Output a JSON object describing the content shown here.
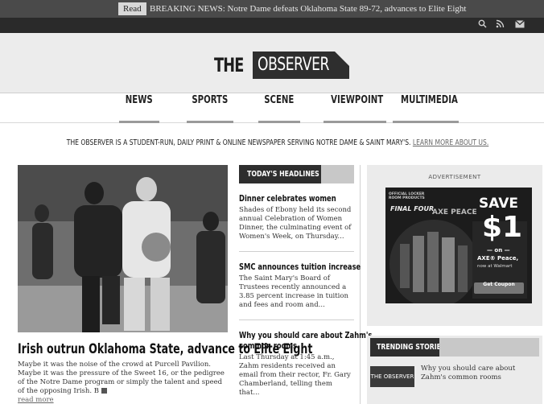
{
  "breaking": {
    "read_label": "Read",
    "text": "BREAKING NEWS: Notre Dame defeats Oklahoma State 89-72, advances to Elite Eight"
  },
  "utility_icons": [
    "search-icon",
    "rss-icon",
    "mail-icon"
  ],
  "masthead": {
    "logo_the": "THE",
    "logo_observer": "OBSERVER"
  },
  "nav": {
    "items": [
      "NEWS",
      "SPORTS",
      "SCENE",
      "VIEWPOINT",
      "MULTIMEDIA"
    ]
  },
  "tagline": {
    "text": "THE OBSERVER IS A STUDENT-RUN, DAILY PRINT & ONLINE NEWSPAPER SERVING NOTRE DAME & SAINT MARY'S.",
    "link": "LEARN MORE ABOUT US."
  },
  "feature": {
    "title": "Irish outrun Oklahoma State, advance to Elite Eight",
    "body": "Maybe it was the noise of the crowd at Purcell Pavilion. Maybe it was the pressure of the Sweet 16, or the pedigree of the Notre Dame program or simply the talent and speed of the opposing Irish. B",
    "read_more": "read more"
  },
  "headlines": {
    "label": "TODAY'S HEADLINES",
    "items": [
      {
        "title": "Dinner celebrates women",
        "body": "Shades of Ebony held its second annual Celebration of Women Dinner, the culminating event of Women's Week, on Thursday..."
      },
      {
        "title": "SMC announces tuition increase",
        "body": "The Saint Mary's Board of Trustees recently announced a 3.85 percent increase in tuition and fees and room and..."
      },
      {
        "title_line1": "Why you should care about Zahm's",
        "title_line2": "common rooms",
        "body": "Last Thursday at 1:45 a.m., Zahm residents received an email from their rector, Fr. Gary Chamberland, telling them that..."
      }
    ]
  },
  "ad": {
    "label": "ADVERTISEMENT",
    "badge": "OFFICIAL LOCKER ROOM PRODUCTS",
    "final_four": "FINAL FOUR",
    "brand": "AXE PEACE",
    "save": "SAVE",
    "amount": "$1",
    "on": "— on —",
    "product": "AXE® Peace,",
    "store": "now at Walmart",
    "cta": "Get Coupon"
  },
  "trending": {
    "label": "TRENDING STORIES",
    "thumb_text": "THE OBSERVER",
    "item": "Why you should care about Zahm's common rooms"
  }
}
